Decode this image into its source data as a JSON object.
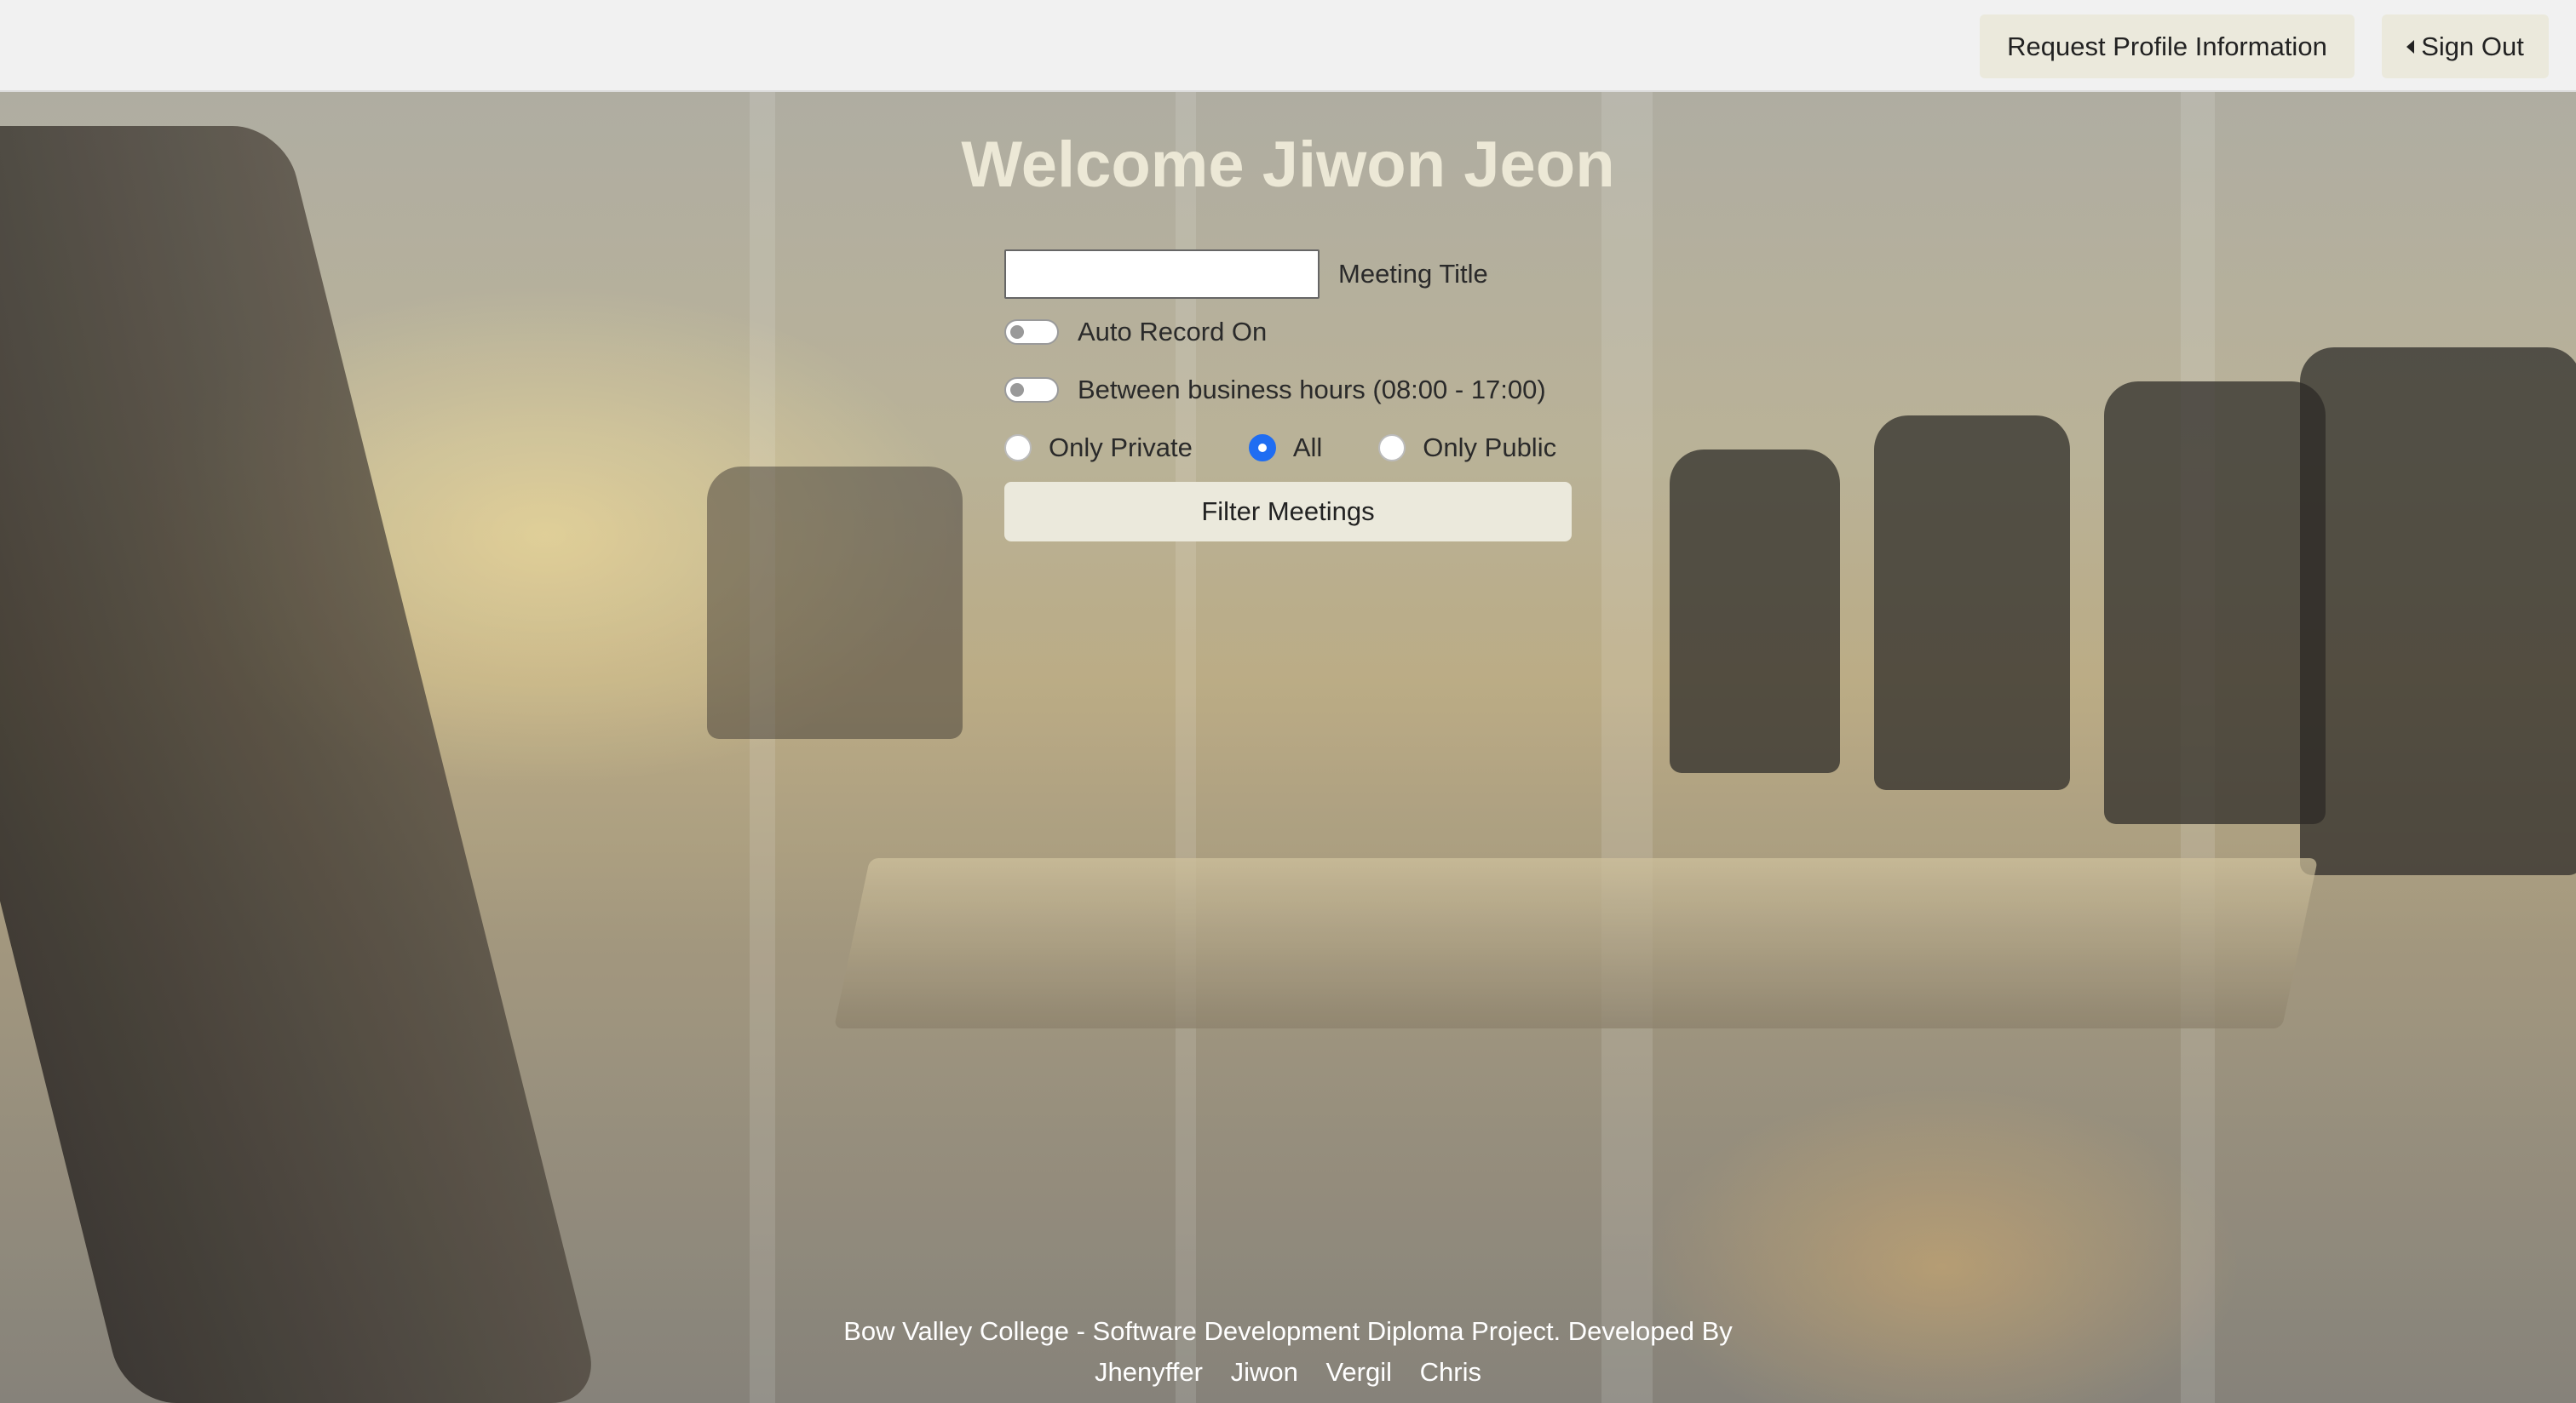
{
  "header": {
    "request_profile_label": "Request Profile Information",
    "sign_out_label": "Sign Out"
  },
  "main": {
    "welcome": "Welcome Jiwon Jeon",
    "meeting_title": {
      "value": "",
      "label": "Meeting Title"
    },
    "auto_record": {
      "label": "Auto Record On",
      "on": false
    },
    "business_hours": {
      "label": "Between business hours (08:00 - 17:00)",
      "on": false
    },
    "visibility": {
      "options": [
        "Only Private",
        "All",
        "Only Public"
      ],
      "selected": "All"
    },
    "filter_button_label": "Filter Meetings"
  },
  "footer": {
    "text": "Bow Valley College - Software Development Diploma Project. Developed By",
    "developers": [
      "Jhenyffer",
      "Jiwon",
      "Vergil",
      "Chris"
    ]
  },
  "colors": {
    "button_bg": "#ebe9dc",
    "welcome_text": "#ece8d6",
    "radio_accent": "#1f6df2"
  }
}
